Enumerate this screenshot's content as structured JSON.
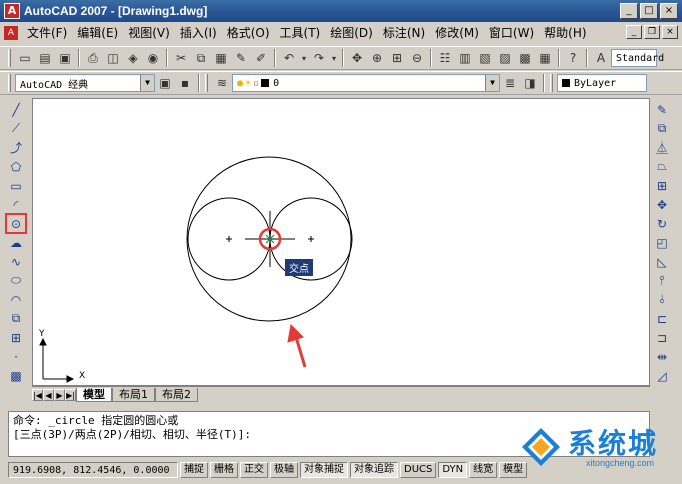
{
  "window": {
    "title": "AutoCAD 2007 - [Drawing1.dwg]"
  },
  "menu": [
    "文件(F)",
    "编辑(E)",
    "视图(V)",
    "插入(I)",
    "格式(O)",
    "工具(T)",
    "绘图(D)",
    "标注(N)",
    "修改(M)",
    "窗口(W)",
    "帮助(H)"
  ],
  "toolbar": {
    "workspace": "AutoCAD 经典",
    "text_style": "Standard",
    "layer": "0",
    "color": "ByLayer"
  },
  "canvas": {
    "tooltip": "交点",
    "ucs_x": "X",
    "ucs_y": "Y"
  },
  "layout_tabs": [
    "模型",
    "布局1",
    "布局2"
  ],
  "command": {
    "line1": "命令: _circle 指定圆的圆心或",
    "line2": "[三点(3P)/两点(2P)/相切、相切、半径(T)]:"
  },
  "status": {
    "coords": "919.6908,  812.4546, 0.0000",
    "buttons": [
      "捕捉",
      "栅格",
      "正交",
      "极轴",
      "对象捕捉",
      "对象追踪",
      "DUCS",
      "DYN",
      "线宽",
      "模型"
    ]
  },
  "watermark": {
    "text": "系统城",
    "sub": "xitongcheng.com"
  },
  "colors": {
    "title_bar": "#2b5797",
    "highlight": "#e53935",
    "arrow": "#e53935"
  }
}
